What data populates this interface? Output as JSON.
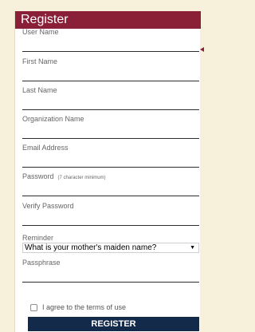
{
  "form": {
    "title": "Register",
    "fields": [
      {
        "label": "User Name"
      },
      {
        "label": "First Name"
      },
      {
        "label": "Last Name"
      },
      {
        "label": "Organization Name"
      },
      {
        "label": "Email Address"
      },
      {
        "label": "Password",
        "hint": "(7 character minimum)"
      },
      {
        "label": "Verify Password"
      }
    ],
    "reminder": {
      "label": "Reminder",
      "selected": "What is your mother's maiden name?"
    },
    "passphrase": {
      "label": "Passphrase"
    },
    "terms_label": "I agree to the terms of use",
    "submit_label": "REGISTER"
  },
  "colors": {
    "header": "#8a1f38",
    "button": "#142a4a",
    "background": "#f7f1dc"
  }
}
